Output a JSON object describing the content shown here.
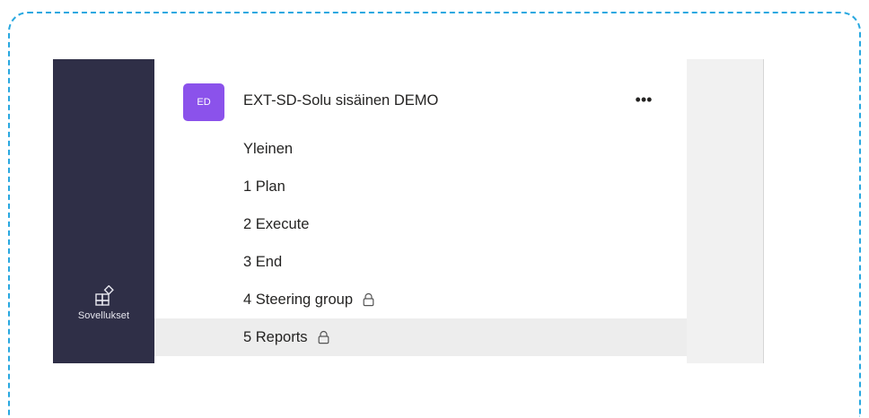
{
  "rail": {
    "apps": {
      "icon": "apps-icon",
      "label": "Sovellukset"
    }
  },
  "team": {
    "avatar_initials": "ED",
    "avatar_color": "#8b52eb",
    "name": "EXT-SD-Solu sisäinen DEMO",
    "more_icon": "more-options-icon",
    "more_label": "•••"
  },
  "channels": [
    {
      "label": "Yleinen",
      "private": false,
      "selected": false
    },
    {
      "label": "1 Plan",
      "private": false,
      "selected": false
    },
    {
      "label": "2 Execute",
      "private": false,
      "selected": false
    },
    {
      "label": "3 End",
      "private": false,
      "selected": false
    },
    {
      "label": "4 Steering group",
      "private": true,
      "selected": false
    },
    {
      "label": "5 Reports",
      "private": true,
      "selected": true
    }
  ],
  "colors": {
    "rail_background": "#2f2f47",
    "frame_border": "#29a8e0",
    "selected_row": "#ededed"
  }
}
